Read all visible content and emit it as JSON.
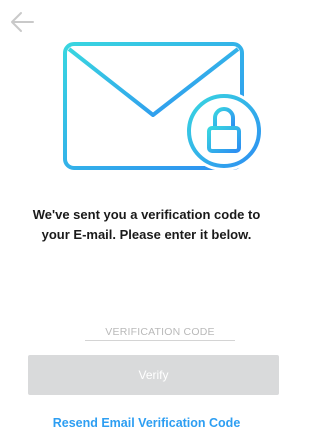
{
  "header": {
    "back_icon": "arrow-left-icon"
  },
  "illustration": {
    "icon": "envelope-lock-icon",
    "gradient_start": "#39d6e0",
    "gradient_end": "#2d8ef2"
  },
  "message": {
    "line1": "We've sent you a verification code to",
    "line2": "your E-mail. Please enter it below."
  },
  "form": {
    "code_value": "",
    "code_placeholder": "VERIFICATION CODE",
    "verify_label": "Verify",
    "verify_enabled": false
  },
  "footer": {
    "resend_label": "Resend Email Verification Code",
    "link_color": "#2d9ef2"
  }
}
